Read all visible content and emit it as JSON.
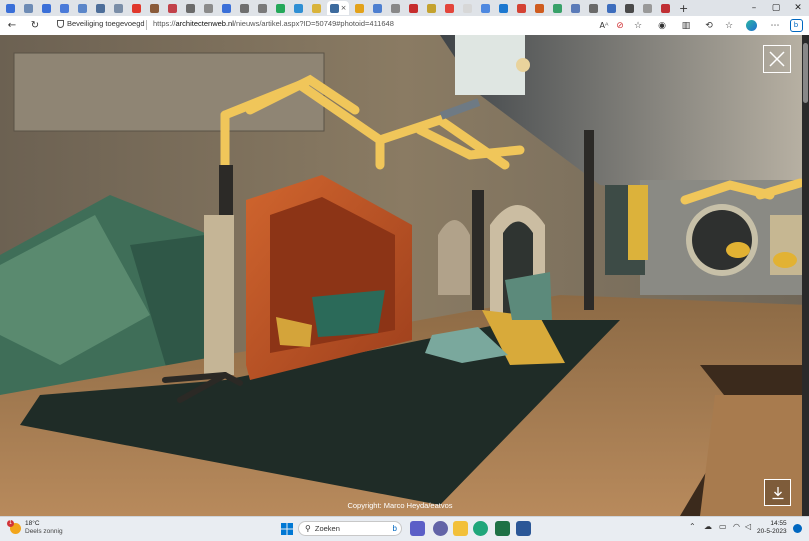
{
  "browser": {
    "tabs_count": 37,
    "active_tab_close": "×",
    "new_tab": "+",
    "window_controls": {
      "minimize": "–",
      "maximize": "▢",
      "close": "✕"
    },
    "security_label": "Beveiliging toegevoegd",
    "url_prefix": "https://",
    "url_domain": "architectenweb.nl",
    "url_path": "/nieuws/artikel.aspx?ID=50749#photoid=411648",
    "reader_icon": "Aᴬ"
  },
  "viewer": {
    "copyright": "Copyright: Marco Heyda/eatvos",
    "close_icon": "close-icon",
    "download_icon": "download-icon"
  },
  "taskbar": {
    "weather_temp": "18°C",
    "weather_desc": "Deels zonnig",
    "weather_badge": "1",
    "search_placeholder": "Zoeken",
    "time": "14:55",
    "date": "20-5-2023"
  },
  "colors": {
    "tab_strip": "#dfe3e8",
    "taskbar": "#e9edf2",
    "accent": "#0067c0"
  }
}
